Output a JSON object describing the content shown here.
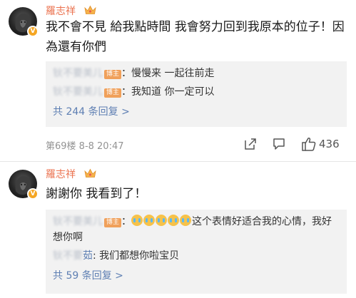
{
  "comments": [
    {
      "author": "羅志祥",
      "text": "我不會不見 給我點時間 我會努力回到我原本的位子！因為還有你們",
      "replies": [
        {
          "user": "钬不要美儿",
          "badge": "博主",
          "text": "：慢慢来 一起往前走"
        },
        {
          "user": "钬不要美儿",
          "badge": "博主",
          "text": "：我知道 你一定可以"
        }
      ],
      "more_replies": "共 244 条回复 >",
      "floor_time": "第69楼 8-8 20:47",
      "like_count": "436"
    },
    {
      "author": "羅志祥",
      "text": "謝謝你 我看到了！",
      "replies": [
        {
          "user": "钬不要美儿",
          "badge": "博主",
          "text": "这个表情好适合我的心情，我好想你啊",
          "emoji_count": 5
        },
        {
          "user": "茹",
          "text": ": 我们都想你啦宝贝"
        }
      ],
      "more_replies": "共 59 条回复 >"
    }
  ],
  "icons": [
    "avatar",
    "verified-v-icon",
    "crown-icon",
    "share-icon",
    "comment-icon",
    "like-icon"
  ],
  "colors": {
    "name": "#eb7350",
    "link": "#5e7fb3",
    "badge": "#f0a05a",
    "reply_bg": "#f2f2f2",
    "verified": "#f5a623"
  }
}
